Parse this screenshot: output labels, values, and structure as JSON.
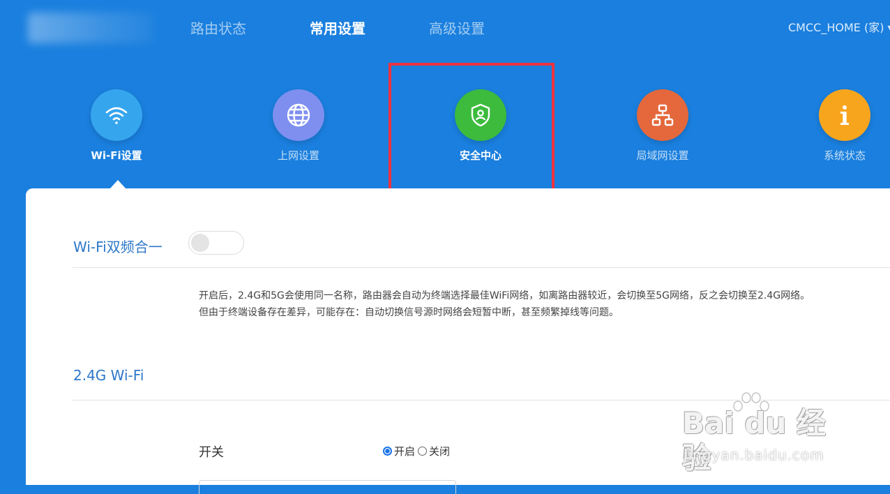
{
  "header": {
    "nav": [
      {
        "label": "路由状态",
        "active": false
      },
      {
        "label": "常用设置",
        "active": true
      },
      {
        "label": "高级设置",
        "active": false
      }
    ],
    "ssid_menu": "CMCC_HOME (家) ▾"
  },
  "features": [
    {
      "label": "Wi-Fi设置",
      "icon": "wifi-icon",
      "color": "#35a5ee",
      "active": true
    },
    {
      "label": "上网设置",
      "icon": "globe-icon",
      "color": "#7e8ff0",
      "active": false
    },
    {
      "label": "安全中心",
      "icon": "shield-user-icon",
      "color": "#3cbb3c",
      "active": false
    },
    {
      "label": "局域网设置",
      "icon": "network-tree-icon",
      "color": "#e4683c",
      "active": false
    },
    {
      "label": "系统状态",
      "icon": "info-icon",
      "color": "#f8a51e",
      "active": false
    }
  ],
  "colors": {
    "header_bg": "#1a7fde",
    "highlight": "#ee3340",
    "section_title": "#2d77c8"
  },
  "panel": {
    "dual_band": {
      "title": "Wi-Fi双频合一",
      "enabled": false,
      "description_line1": "开启后，2.4G和5G会使用同一名称，路由器会自动为终端选择最佳WiFi网络，如离路由器较近，会切换至5G网络，反之会切换至2.4G网络。",
      "description_line2": "但由于终端设备存在差异，可能存在：自动切换信号源时网络会短暂中断，甚至频繁掉线等问题。"
    },
    "wifi24": {
      "title": "2.4G Wi-Fi",
      "switch_label": "开关",
      "option_on": "开启",
      "option_off": "关闭",
      "selected": "开启"
    }
  },
  "watermark": {
    "brand": "Bai du 经验",
    "url": "jingyan.baidu.com"
  }
}
